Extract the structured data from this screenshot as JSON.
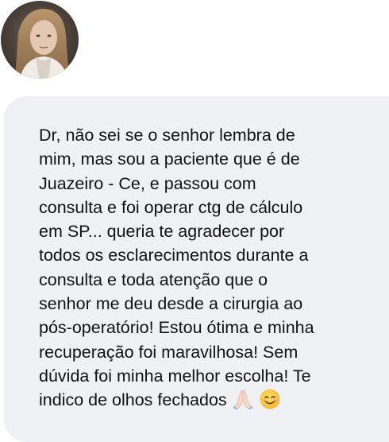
{
  "message": {
    "lines": [
      "Dr, não sei se o senhor lembra de",
      "mim, mas sou a paciente que é de",
      "Juazeiro - Ce, e passou com",
      "consulta e foi operar ctg de cálculo",
      "em SP... queria te agradecer por",
      "todos os esclarecimentos durante a",
      "consulta e toda atenção que o",
      "senhor me deu desde a cirurgia ao",
      "pós-operatório! Estou ótima e minha",
      "recuperação foi maravilhosa! Sem",
      "dúvida foi minha melhor escolha! Te",
      "indico de olhos fechados"
    ],
    "emojis": [
      "folded-hands-icon",
      "smiling-face-icon"
    ]
  },
  "colors": {
    "background": "#ffffff",
    "bubble": "#f0f1f4",
    "text": "#111111"
  }
}
